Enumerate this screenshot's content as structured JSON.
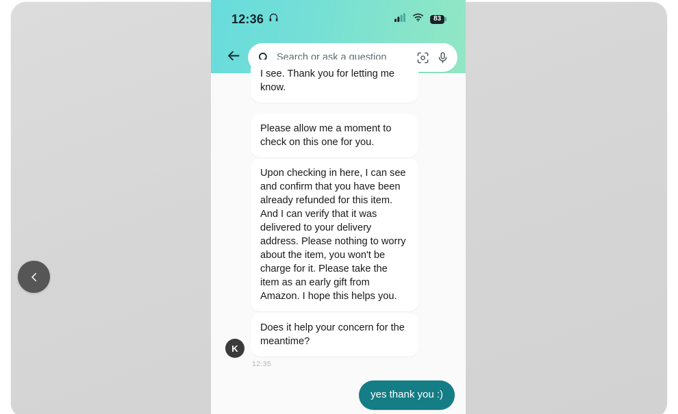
{
  "viewer": {
    "prev_button_label": "Previous",
    "prev_icon": "chevron-left-icon",
    "background_color": "#d6d6d6"
  },
  "phone": {
    "status_bar": {
      "time": "12:36",
      "headphones_icon": "headphones-icon",
      "signal_icon": "cellular-signal-icon",
      "wifi_icon": "wifi-icon",
      "battery_level": "83",
      "battery_icon": "battery-icon"
    },
    "header": {
      "gradient_from": "#68dcdc",
      "gradient_to": "#92e7c4",
      "back_icon": "arrow-left-icon"
    },
    "search": {
      "placeholder": "Search or ask a question",
      "value": "",
      "search_icon": "search-icon",
      "camera_icon": "camera-scan-icon",
      "mic_icon": "microphone-icon"
    },
    "chat": {
      "accent_color": "#147d85",
      "avatar_initial": "K",
      "timestamp": "12:35",
      "messages": [
        {
          "sender": "agent",
          "text": "I see. Thank you for letting me know.",
          "clipped": true
        },
        {
          "sender": "agent",
          "text": "Please allow me a moment to check on this one for you."
        },
        {
          "sender": "agent",
          "text": "Upon checking in here, I can see and confirm that you have been already refunded for this item. And I can verify that it was delivered to your delivery address. Please nothing to worry about the item, you won't be charge for it. Please take the item as an early gift from Amazon. I hope this helps you."
        },
        {
          "sender": "agent",
          "text": "Does it help your concern for the meantime?"
        },
        {
          "sender": "user",
          "text": "yes thank you :)"
        }
      ]
    }
  }
}
